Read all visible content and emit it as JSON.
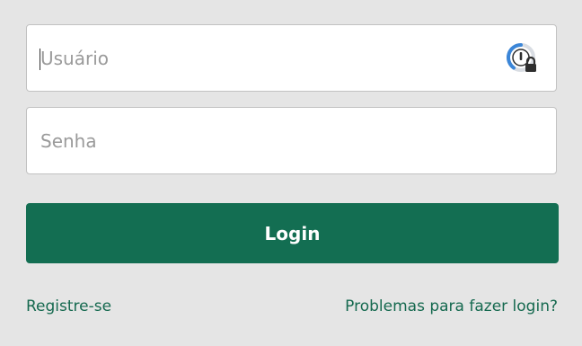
{
  "form": {
    "username": {
      "placeholder": "Usuário",
      "value": ""
    },
    "password": {
      "placeholder": "Senha",
      "value": ""
    },
    "login_label": "Login"
  },
  "links": {
    "register": "Registre-se",
    "trouble": "Problemas para fazer login?"
  },
  "icons": {
    "password_manager": "password-manager-lock-icon"
  },
  "colors": {
    "background": "#e5e5e5",
    "accent": "#136e52",
    "link": "#15694f",
    "password_manager_blue": "#3b86d8"
  }
}
